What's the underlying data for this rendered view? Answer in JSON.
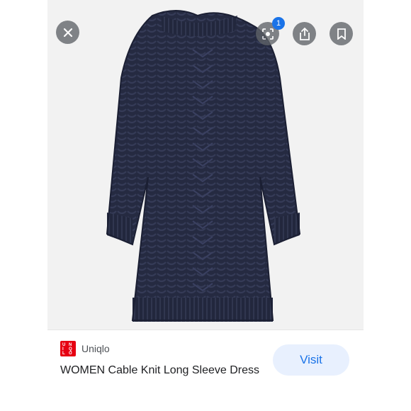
{
  "source": {
    "logo": "uniqlo-logo",
    "logo_color": "#e60012",
    "name": "Uniqlo"
  },
  "product": {
    "title": "WOMEN Cable Knit Long Sleeve Dress",
    "image": "navy-cable-knit-dress"
  },
  "actions": {
    "visit_label": "Visit",
    "lens_badge_count": "1"
  },
  "icons": {
    "close": "close-icon",
    "lens": "lens-icon",
    "share": "share-icon",
    "save": "bookmark-icon"
  },
  "colors": {
    "accent": "#1a73e8",
    "visit_bg": "#e8f0fe",
    "overlay_button": "#5f6368",
    "dress": "#23283f"
  }
}
